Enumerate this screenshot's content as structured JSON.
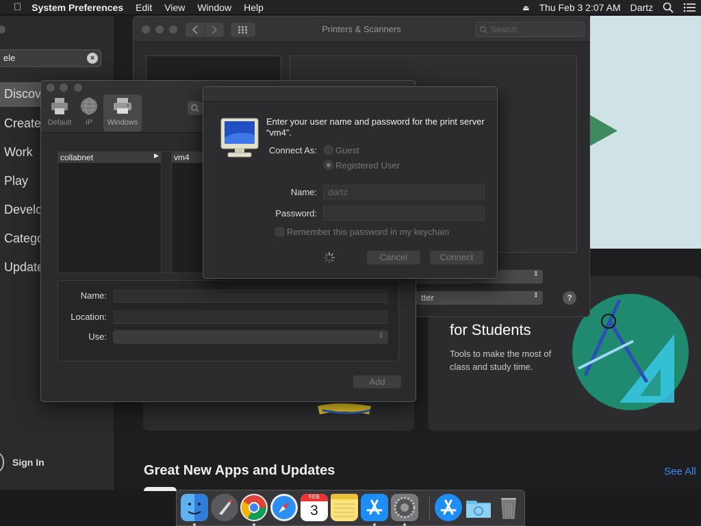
{
  "menubar": {
    "app_name": "System Preferences",
    "menus": [
      "Edit",
      "View",
      "Window",
      "Help"
    ],
    "datetime": "Thu Feb 3  2:07 AM",
    "user": "Dartz"
  },
  "app_store": {
    "search_value": "ele",
    "sidebar_items": [
      "Discover",
      "Create",
      "Work",
      "Play",
      "Develop",
      "Categories",
      "Updates"
    ],
    "selected_item": "Discover",
    "sign_in_label": "Sign In",
    "card_title": "for Students",
    "card_desc": "Tools to make the most of class and study time.",
    "section_title": "Great New Apps and Updates",
    "see_all_label": "See All"
  },
  "printers_window": {
    "title": "Printers & Scanners",
    "search_placeholder": "Search",
    "popup1_value": "",
    "popup2_value": "tter",
    "help_label": "?"
  },
  "add_window": {
    "toolbar": [
      {
        "label": "Default",
        "icon": "printer-icon"
      },
      {
        "label": "IP",
        "icon": "globe-icon"
      },
      {
        "label": "Windows",
        "icon": "windows-printer-icon"
      }
    ],
    "selected_toolbar": "Windows",
    "column1_selected": "collabnet",
    "column2_selected": "vm4",
    "form": {
      "name_label": "Name:",
      "location_label": "Location:",
      "use_label": "Use:",
      "name_value": "",
      "location_value": "",
      "use_value": ""
    },
    "add_button": "Add"
  },
  "auth_sheet": {
    "message": "Enter your user name and password for the print server “vm4”.",
    "connect_as_label": "Connect As:",
    "options": [
      "Guest",
      "Registered User"
    ],
    "selected_option": "Registered User",
    "name_label": "Name:",
    "name_value": "dartz",
    "password_label": "Password:",
    "password_value": "",
    "remember_label": "Remember this password in my keychain",
    "remember_checked": false,
    "cancel_button": "Cancel",
    "connect_button": "Connect"
  },
  "dock": {
    "apps": [
      "Finder",
      "Launchpad",
      "Chrome",
      "Safari",
      "Calendar",
      "Notes",
      "App Store",
      "System Preferences",
      "App Store",
      "Downloads",
      "Trash"
    ],
    "calendar_month": "FEB",
    "calendar_day": "3"
  }
}
